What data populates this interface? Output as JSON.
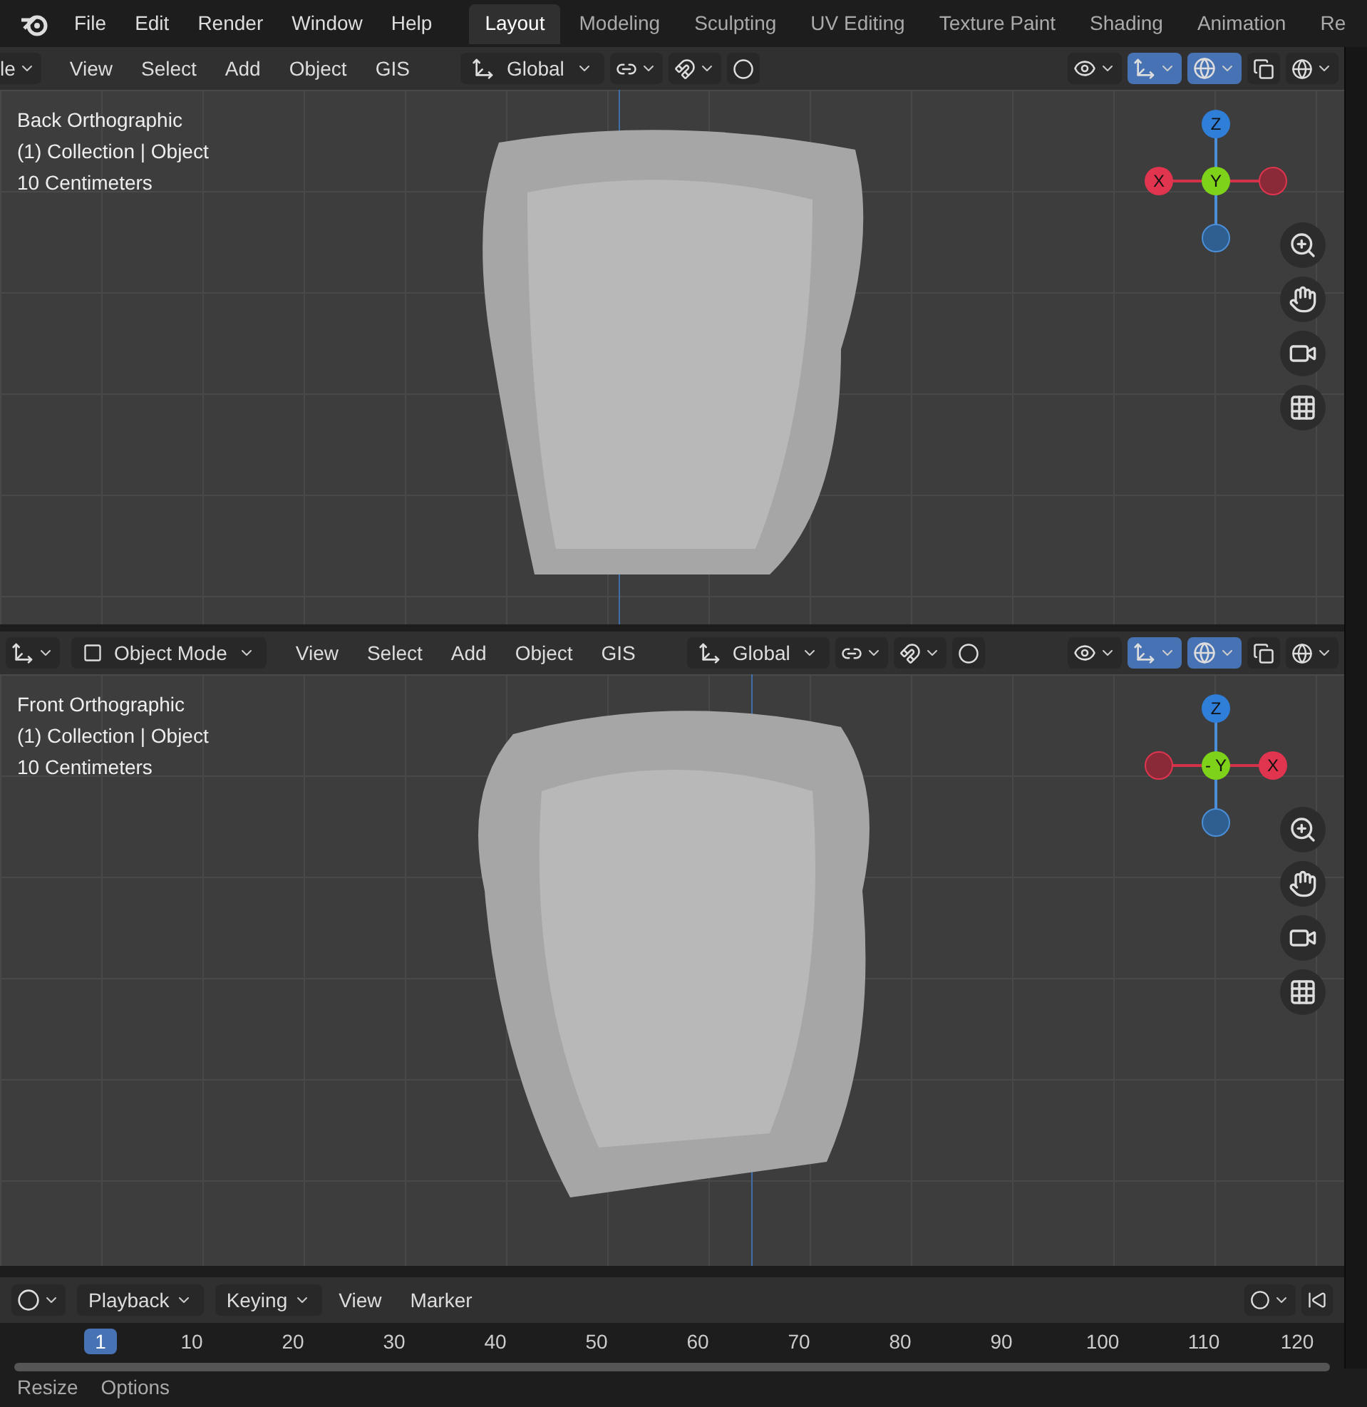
{
  "menu": [
    "File",
    "Edit",
    "Render",
    "Window",
    "Help"
  ],
  "workspaces": [
    {
      "label": "Layout",
      "selected": true
    },
    {
      "label": "Modeling",
      "selected": false
    },
    {
      "label": "Sculpting",
      "selected": false
    },
    {
      "label": "UV Editing",
      "selected": false
    },
    {
      "label": "Texture Paint",
      "selected": false
    },
    {
      "label": "Shading",
      "selected": false
    },
    {
      "label": "Animation",
      "selected": false
    },
    {
      "label": "Re",
      "selected": false
    }
  ],
  "viewports": [
    {
      "header": {
        "editor_label": "le",
        "menus": [
          "View",
          "Select",
          "Add",
          "Object",
          "GIS"
        ],
        "orientation": "Global"
      },
      "overlay": [
        "Back Orthographic",
        "(1) Collection | Object",
        "10 Centimeters"
      ],
      "gizmo": {
        "top": "Z",
        "center": "Y",
        "left": "X"
      }
    },
    {
      "header": {
        "mode": "Object Mode",
        "menus": [
          "View",
          "Select",
          "Add",
          "Object",
          "GIS"
        ],
        "orientation": "Global"
      },
      "overlay": [
        "Front Orthographic",
        "(1) Collection | Object",
        "10 Centimeters"
      ],
      "gizmo": {
        "top": "Z",
        "center": "- Y",
        "right": "X"
      }
    }
  ],
  "timeline": {
    "menus": [
      "Playback",
      "Keying",
      "View",
      "Marker"
    ],
    "frames": [
      {
        "label": "1",
        "selected": true
      },
      {
        "label": "10",
        "selected": false
      },
      {
        "label": "20",
        "selected": false
      },
      {
        "label": "30",
        "selected": false
      },
      {
        "label": "40",
        "selected": false
      },
      {
        "label": "50",
        "selected": false
      },
      {
        "label": "60",
        "selected": false
      },
      {
        "label": "70",
        "selected": false
      },
      {
        "label": "80",
        "selected": false
      },
      {
        "label": "90",
        "selected": false
      },
      {
        "label": "100",
        "selected": false
      },
      {
        "label": "110",
        "selected": false
      },
      {
        "label": "120",
        "selected": false
      }
    ]
  },
  "status_bar": [
    "Resize",
    "Options"
  ]
}
